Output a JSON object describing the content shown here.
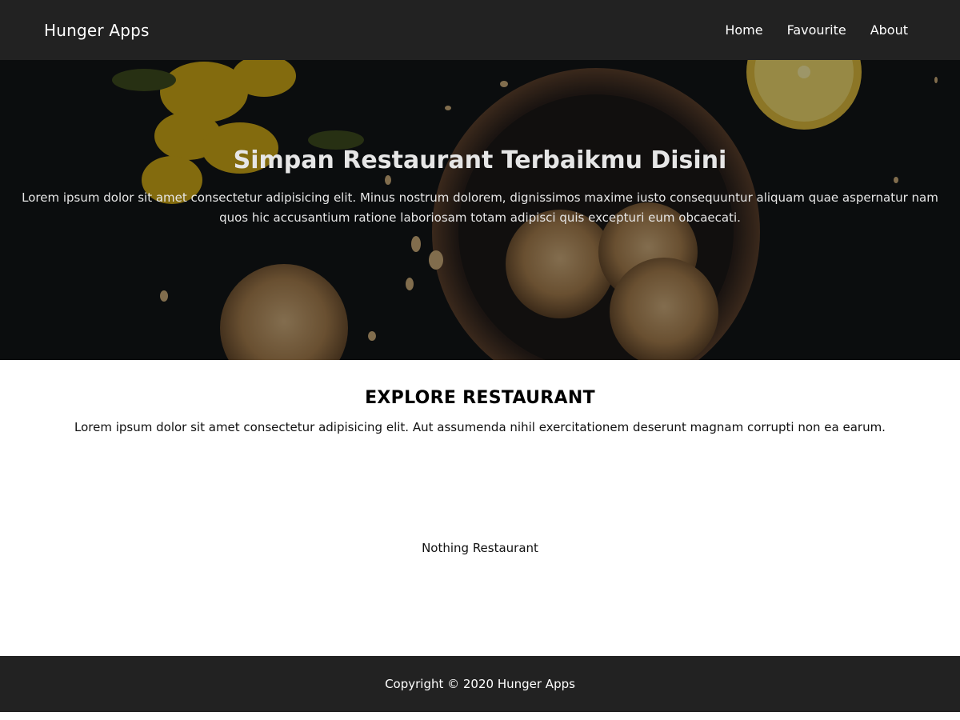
{
  "navbar": {
    "brand": "Hunger Apps",
    "links": [
      "Home",
      "Favourite",
      "About"
    ]
  },
  "hero": {
    "title": "Simpan Restaurant Terbaikmu Disini",
    "text": "Lorem ipsum dolor sit amet consectetur adipisicing elit. Minus nostrum dolorem, dignissimos maxime iusto consequuntur aliquam quae aspernatur nam quos hic accusantium ratione laboriosam totam adipisci quis excepturi eum obcaecati."
  },
  "explore": {
    "title": "EXPLORE RESTAURANT",
    "text": "Lorem ipsum dolor sit amet consectetur adipisicing elit. Aut assumenda nihil exercitationem deserunt magnam corrupti non ea earum."
  },
  "empty_message": "Nothing Restaurant",
  "footer": {
    "copyright": "Copyright © 2020 Hunger Apps"
  },
  "colors": {
    "nav_bg": "#222222",
    "hero_bg": "#0f1113",
    "text_light": "#e6e6e6"
  }
}
